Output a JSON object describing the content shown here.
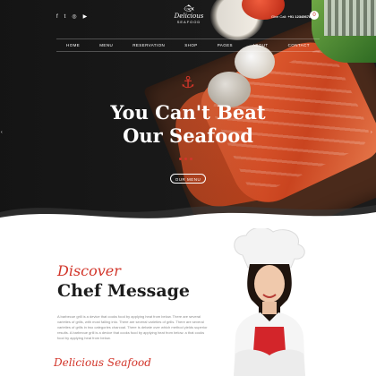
{
  "header": {
    "social_icons": [
      "facebook-icon",
      "twitter-icon",
      "instagram-icon",
      "youtube-icon"
    ],
    "logo": {
      "script": "Delicious",
      "sub": "SEAFOOD"
    },
    "call_label": "Give Call:",
    "phone": "+91 123456789",
    "cart_count": "0"
  },
  "nav": {
    "items": [
      "HOME",
      "MENU",
      "RESERVATION",
      "SHOP",
      "PAGES",
      "ABOUT",
      "CONTACT"
    ]
  },
  "hero": {
    "headline_line1": "You Can't Beat",
    "headline_line2": "Our Seafood",
    "button_label": "OUR MENU"
  },
  "about": {
    "script_title": "Discover",
    "title": "Chef Message",
    "paragraph": "A barbecue grill is a device that cooks food by applying heat from below. There are several varieties of grills, with most falling into. There are several varieties of grills. There are several varieties of grills in two categories charcoal. There is debate over which method yields superior results. A barbecue grill is a device that cooks food by applying heat from below. a that cooks food by applying heat from below.",
    "signature": "Delicious Seafood"
  },
  "colors": {
    "accent": "#d2352a",
    "dark_bg": "#1b1b1b",
    "text_dark": "#1c1c1c"
  }
}
